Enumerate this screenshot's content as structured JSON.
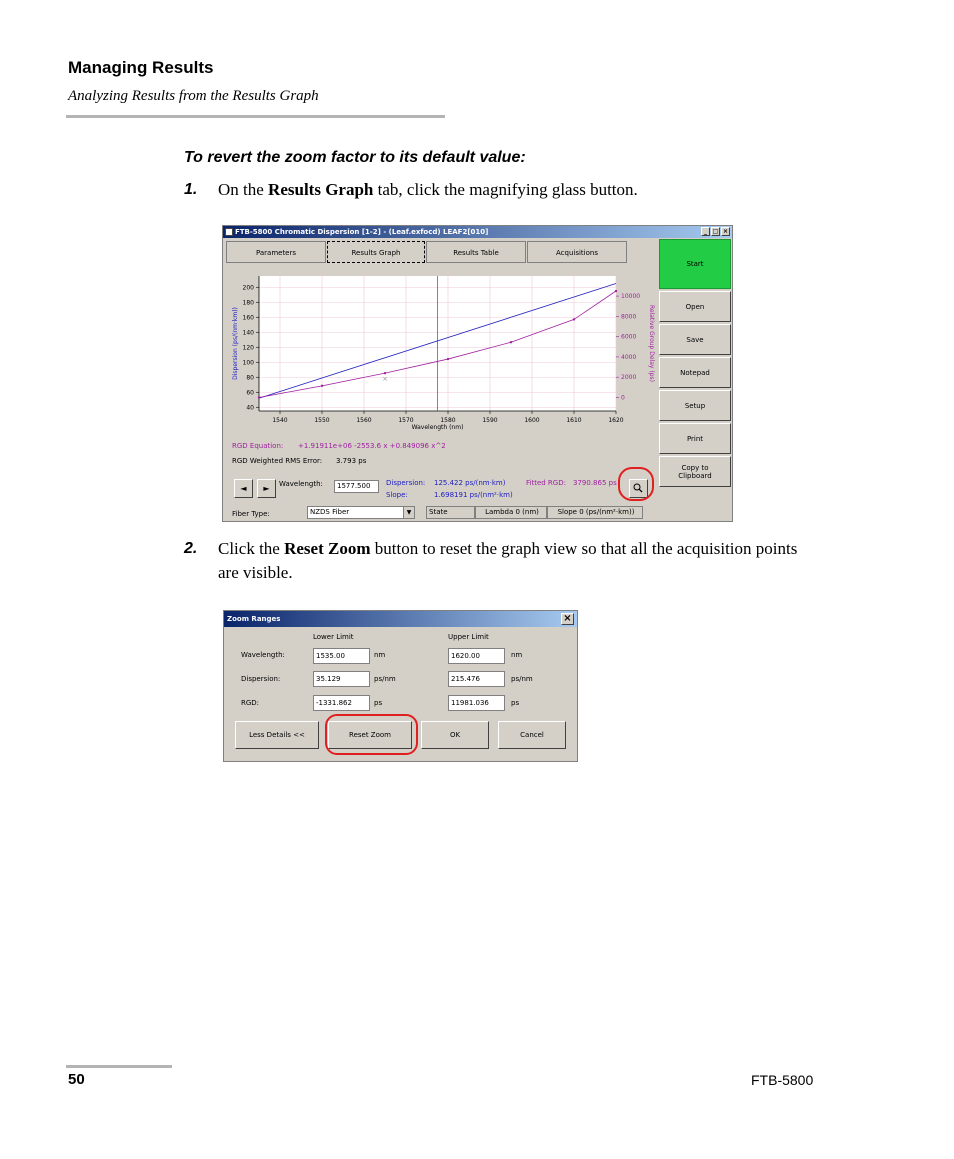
{
  "header": {
    "title": "Managing Results",
    "subtitle": "Analyzing Results from the Results Graph"
  },
  "procedure": {
    "title": "To revert the zoom factor to its default value:",
    "step1": {
      "num": "1.",
      "pre": "On the ",
      "bold": "Results Graph",
      "post": " tab, click the magnifying glass button."
    },
    "step2": {
      "num": "2.",
      "pre": "Click the ",
      "bold": "Reset Zoom",
      "post": " button to reset the graph view so that all the acquisition points are visible."
    }
  },
  "window": {
    "title": "FTB-5800 Chromatic Dispersion  [1-2] - (Leaf.exfocd) LEAF2[010]",
    "tabs": [
      "Parameters",
      "Results Graph",
      "Results Table",
      "Acquisitions"
    ],
    "side_buttons": [
      "Start",
      "Open",
      "Save",
      "Notepad",
      "Setup",
      "Print",
      "Copy to Clipboard"
    ],
    "rgd_equation_label": "RGD Equation:",
    "rgd_equation": "+1.91911e+06 -2553.6 x +0.849096 x^2",
    "rms_label": "RGD Weighted RMS Error:",
    "rms_value": "3.793 ps",
    "wavelength_label": "Wavelength:",
    "wavelength_value": "1577.500",
    "dispersion_label": "Dispersion:",
    "dispersion_value": "125.422 ps/(nm·km)",
    "slope_label": "Slope:",
    "slope_value": "1.698191 ps/(nm²·km)",
    "fitted_rgd_label": "Fitted RGD:",
    "fitted_rgd_value": "3790.865 ps",
    "fiber_type_label": "Fiber Type:",
    "fiber_type_value": "NZDS Fiber",
    "status_cols": [
      "State",
      "Lambda  0  (nm)",
      "Slope 0 (ps/(nm²·km))"
    ],
    "prev_glyph": "◄",
    "next_glyph": "►",
    "zoom_icon": "magnifier-icon"
  },
  "chart_data": {
    "type": "line",
    "xlabel": "Wavelength (nm)",
    "ylabel": "Dispersion (ps/(nm·km))",
    "y2label": "Relative Group Delay (ps)",
    "xlim": [
      1535,
      1620
    ],
    "ylim": [
      35,
      215
    ],
    "y2lim": [
      -1331.862,
      11981.036
    ],
    "x_ticks": [
      1540,
      1550,
      1560,
      1570,
      1580,
      1590,
      1600,
      1610,
      1620
    ],
    "y_ticks": [
      40,
      60,
      80,
      100,
      120,
      140,
      160,
      180,
      200
    ],
    "y2_ticks": [
      0,
      2000,
      4000,
      6000,
      8000,
      10000
    ],
    "cursor_x": 1577.5,
    "series": [
      {
        "color": "#2020c0",
        "axis": "y",
        "x": [
          1535,
          1620
        ],
        "y": [
          52,
          205
        ]
      },
      {
        "color": "#a020a0",
        "axis": "y2",
        "x": [
          1535,
          1550,
          1565,
          1580,
          1595,
          1610,
          1620
        ],
        "y": [
          0,
          1150,
          2400,
          3790,
          5450,
          7700,
          10500
        ]
      }
    ],
    "outlier": {
      "x": 1565,
      "y": 78
    },
    "grid": true
  },
  "dialog": {
    "title": "Zoom Ranges",
    "close_glyph": "×",
    "lower_header": "Lower Limit",
    "upper_header": "Upper Limit",
    "rows": [
      {
        "label": "Wavelength:",
        "lower": "1535.00",
        "lower_unit": "nm",
        "upper": "1620.00",
        "upper_unit": "nm"
      },
      {
        "label": "Dispersion:",
        "lower": "35.129",
        "lower_unit": "ps/nm",
        "upper": "215.476",
        "upper_unit": "ps/nm"
      },
      {
        "label": "RGD:",
        "lower": "-1331.862",
        "lower_unit": "ps",
        "upper": "11981.036",
        "upper_unit": "ps"
      }
    ],
    "buttons": [
      "Less Details <<",
      "Reset Zoom",
      "OK",
      "Cancel"
    ]
  },
  "footer": {
    "page": "50",
    "product": "FTB-5800"
  }
}
